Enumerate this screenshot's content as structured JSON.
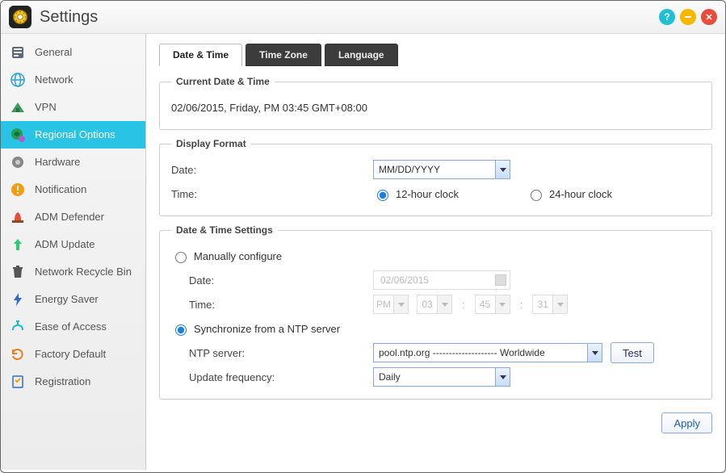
{
  "window": {
    "title": "Settings"
  },
  "titlebar": {
    "help_icon_glyph": "?"
  },
  "sidebar": {
    "items": [
      {
        "id": "general",
        "label": "General",
        "icon_color": "#5a6a7a"
      },
      {
        "id": "network",
        "label": "Network",
        "icon_color": "#2aa0d8"
      },
      {
        "id": "vpn",
        "label": "VPN",
        "icon_color": "#3a9a60"
      },
      {
        "id": "regional",
        "label": "Regional Options",
        "icon_color": "#20a050",
        "selected": true
      },
      {
        "id": "hardware",
        "label": "Hardware",
        "icon_color": "#7a7a7a"
      },
      {
        "id": "notification",
        "label": "Notification",
        "icon_color": "#f39c12"
      },
      {
        "id": "admdefender",
        "label": "ADM Defender",
        "icon_color": "#e74c3c"
      },
      {
        "id": "admupdate",
        "label": "ADM Update",
        "icon_color": "#2ecc71"
      },
      {
        "id": "recyclebin",
        "label": "Network Recycle Bin",
        "icon_color": "#555"
      },
      {
        "id": "energy",
        "label": "Energy Saver",
        "icon_color": "#2d6bd0"
      },
      {
        "id": "ease",
        "label": "Ease of Access",
        "icon_color": "#1fb9d1"
      },
      {
        "id": "factory",
        "label": "Factory Default",
        "icon_color": "#e67e22"
      },
      {
        "id": "registration",
        "label": "Registration",
        "icon_color": "#f39c12"
      }
    ]
  },
  "tabs": [
    {
      "id": "datetime",
      "label": "Date & Time",
      "active": true
    },
    {
      "id": "timezone",
      "label": "Time Zone"
    },
    {
      "id": "language",
      "label": "Language"
    }
  ],
  "current": {
    "legend": "Current Date & Time",
    "value": "02/06/2015, Friday, PM 03:45 GMT+08:00"
  },
  "display_format": {
    "legend": "Display Format",
    "date_label": "Date:",
    "date_value": "MM/DD/YYYY",
    "time_label": "Time:",
    "option_12h": "12-hour clock",
    "option_24h": "24-hour clock",
    "selected": "12h"
  },
  "settings": {
    "legend": "Date & Time Settings",
    "manual_label": "Manually configure",
    "ntp_label": "Synchronize from a NTP server",
    "selected_mode": "ntp",
    "manual_date_label": "Date:",
    "manual_date_value": "02/06/2015",
    "manual_time_label": "Time:",
    "manual_time": {
      "ampm": "PM",
      "hour": "03",
      "minute": "45",
      "second": "31"
    },
    "ntp_server_label": "NTP server:",
    "ntp_server_value": "pool.ntp.org -------------------- Worldwide",
    "test_label": "Test",
    "freq_label": "Update frequency:",
    "freq_value": "Daily"
  },
  "footer": {
    "apply": "Apply"
  }
}
